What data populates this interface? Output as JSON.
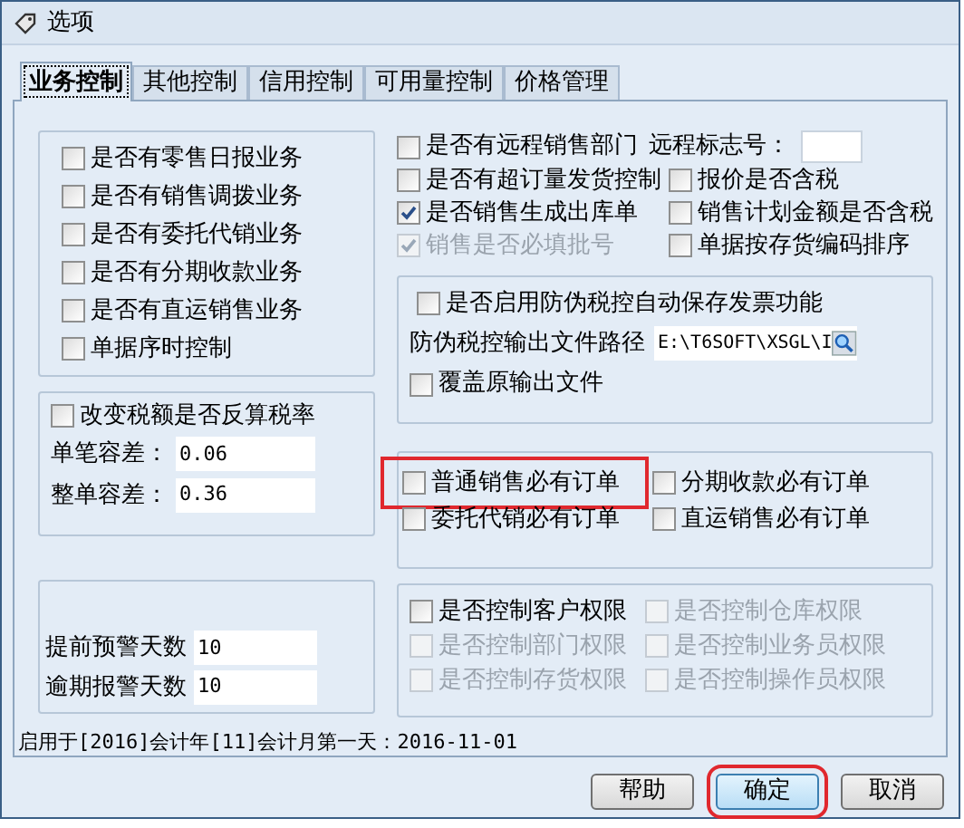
{
  "window": {
    "title": "选项"
  },
  "tabs": [
    {
      "label": "业务控制",
      "selected": true
    },
    {
      "label": "其他控制",
      "selected": false
    },
    {
      "label": "信用控制",
      "selected": false
    },
    {
      "label": "可用量控制",
      "selected": false
    },
    {
      "label": "价格管理",
      "selected": false
    }
  ],
  "business_types": [
    {
      "label": "是否有零售日报业务",
      "checked": false
    },
    {
      "label": "是否有销售调拨业务",
      "checked": false
    },
    {
      "label": "是否有委托代销业务",
      "checked": false
    },
    {
      "label": "是否有分期收款业务",
      "checked": false
    },
    {
      "label": "是否有直运销售业务",
      "checked": false
    },
    {
      "label": "单据序时控制",
      "checked": false
    }
  ],
  "tax_group": {
    "checkbox": {
      "label": "改变税额是否反算税率",
      "checked": false
    },
    "fields": [
      {
        "label": "单笔容差：",
        "value": "0.06"
      },
      {
        "label": "整单容差：",
        "value": "0.36"
      }
    ]
  },
  "alert_group": {
    "fields": [
      {
        "label": "提前预警天数",
        "value": "10"
      },
      {
        "label": "逾期报警天数",
        "value": "10"
      }
    ]
  },
  "remote": {
    "checkbox": {
      "label": "是否有远程销售部门",
      "checked": false
    },
    "id_label": "远程标志号："
  },
  "options": [
    {
      "label": "是否有超订量发货控制",
      "checked": false,
      "disabled": false
    },
    {
      "label": "报价是否含税",
      "checked": false,
      "disabled": false
    },
    {
      "label": "是否销售生成出库单",
      "checked": true,
      "disabled": false
    },
    {
      "label": "销售计划金额是否含税",
      "checked": false,
      "disabled": false
    },
    {
      "label": "销售是否必填批号",
      "checked": true,
      "disabled": true
    },
    {
      "label": "单据按存货编码排序",
      "checked": false,
      "disabled": false
    }
  ],
  "tax_control_group": {
    "checkbox": {
      "label": "是否启用防伪税控自动保存发票功能",
      "checked": false
    },
    "path_label": "防伪税控输出文件路径",
    "path_value": "E:\\T6SOFT\\XSGL\\I",
    "overwrite": {
      "label": "覆盖原输出文件",
      "checked": false
    }
  },
  "order_group": [
    {
      "label": "普通销售必有订单",
      "checked": false,
      "highlighted": true
    },
    {
      "label": "分期收款必有订单",
      "checked": false,
      "highlighted": false
    },
    {
      "label": "委托代销必有订单",
      "checked": false,
      "highlighted": false
    },
    {
      "label": "直运销售必有订单",
      "checked": false,
      "highlighted": false
    }
  ],
  "permission_group": [
    {
      "label": "是否控制客户权限",
      "checked": false,
      "disabled": false
    },
    {
      "label": "是否控制仓库权限",
      "checked": false,
      "disabled": true
    },
    {
      "label": "是否控制部门权限",
      "checked": false,
      "disabled": true
    },
    {
      "label": "是否控制业务员权限",
      "checked": false,
      "disabled": true
    },
    {
      "label": "是否控制存货权限",
      "checked": false,
      "disabled": true
    },
    {
      "label": "是否控制操作员权限",
      "checked": false,
      "disabled": true
    }
  ],
  "footer_text": "启用于[2016]会计年[11]会计月第一天：2016-11-01",
  "buttons": [
    {
      "label": "帮助",
      "highlighted": false
    },
    {
      "label": "确定",
      "highlighted": true
    },
    {
      "label": "取消",
      "highlighted": false
    }
  ]
}
